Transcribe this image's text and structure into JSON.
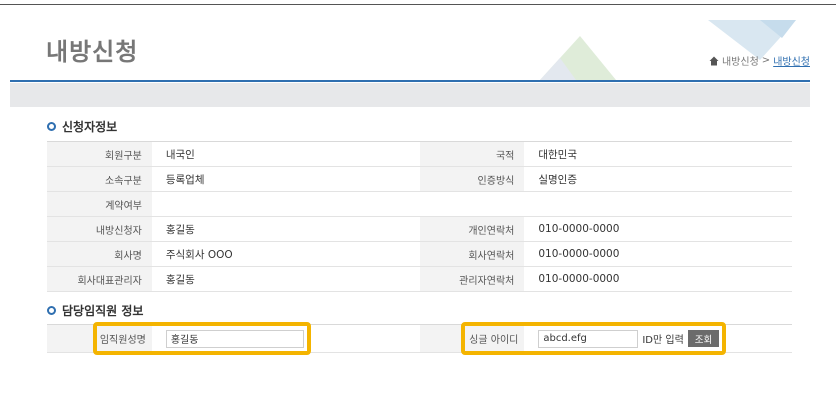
{
  "header": {
    "title": "내방신청",
    "breadcrumb": {
      "home": "내방신청",
      "separator": ">",
      "current": "내방신청"
    }
  },
  "colors": {
    "accent": "#2f6fb0",
    "highlight": "#f4b400",
    "label_bg": "#f3f3f3",
    "button_bg": "#6b6b6b"
  },
  "applicant": {
    "section_title": "신청자정보",
    "rows": [
      {
        "l1": "회원구분",
        "v1": "내국인",
        "l2": "국적",
        "v2": "대한민국"
      },
      {
        "l1": "소속구분",
        "v1": "등록업체",
        "l2": "인증방식",
        "v2": "실명인증"
      },
      {
        "l1": "계약여부",
        "v1": ""
      },
      {
        "l1": "내방신청자",
        "v1": "홍길동",
        "l2": "개인연락처",
        "v2": "010-0000-0000"
      },
      {
        "l1": "회사명",
        "v1": "주식회사 OOO",
        "l2": "회사연락처",
        "v2": "010-0000-0000"
      },
      {
        "l1": "회사대표관리자",
        "v1": "홍길동",
        "l2": "관리자연락처",
        "v2": "010-0000-0000"
      }
    ]
  },
  "staff": {
    "section_title": "담당임직원 정보",
    "name_label": "임직원성명",
    "name_value": "홍길동",
    "id_label": "싱글 아이디",
    "id_value": "abcd.efg",
    "id_note": "ID만 입력",
    "lookup_label": "조회"
  }
}
